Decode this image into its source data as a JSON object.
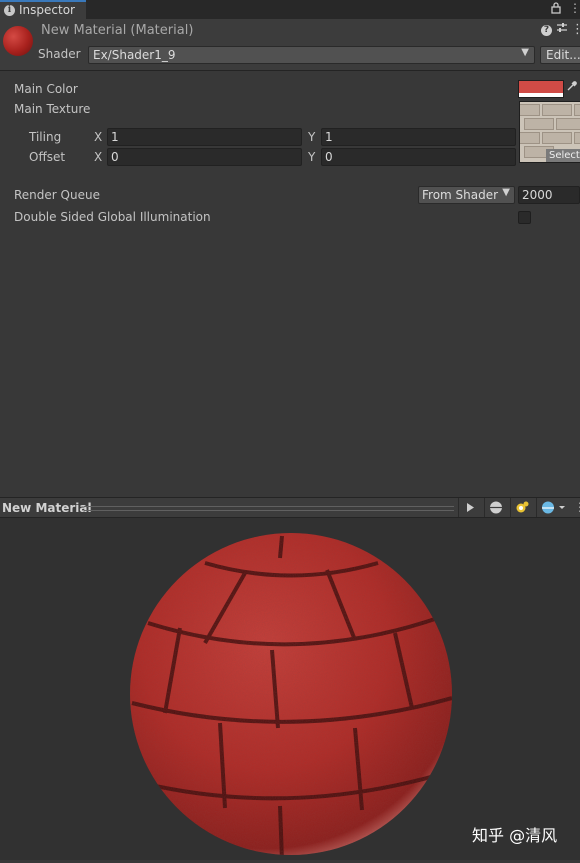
{
  "window": {
    "tab_label": "Inspector",
    "tab_icon": "info-icon",
    "icons": [
      "lock-icon",
      "menu-icon"
    ]
  },
  "header": {
    "title": "New Material (Material)",
    "shader_label": "Shader",
    "shader_value": "Ex/Shader1_9",
    "edit_label": "Edit...",
    "help_icon": "?",
    "preset_icon": "presets-icon",
    "menu_icon": "⋮"
  },
  "properties": {
    "main_color": {
      "label": "Main Color",
      "color": "#d04b46"
    },
    "main_texture": {
      "label": "Main Texture",
      "select_label": "Select"
    },
    "tiling": {
      "label": "Tiling",
      "x_label": "X",
      "x_value": "1",
      "y_label": "Y",
      "y_value": "1"
    },
    "offset": {
      "label": "Offset",
      "x_label": "X",
      "x_value": "0",
      "y_label": "Y",
      "y_value": "0"
    },
    "render_queue": {
      "label": "Render Queue",
      "mode": "From Shader",
      "value": "2000"
    },
    "double_sided_gi": {
      "label": "Double Sided Global Illumination",
      "checked": false
    }
  },
  "preview": {
    "title": "New Material",
    "buttons": [
      "play-icon",
      "sphere-mesh-icon",
      "light-icon",
      "background-sphere-icon",
      "more-icon"
    ],
    "sphere_color": "#b32a26"
  },
  "watermark": {
    "text": "知乎 @清风"
  }
}
